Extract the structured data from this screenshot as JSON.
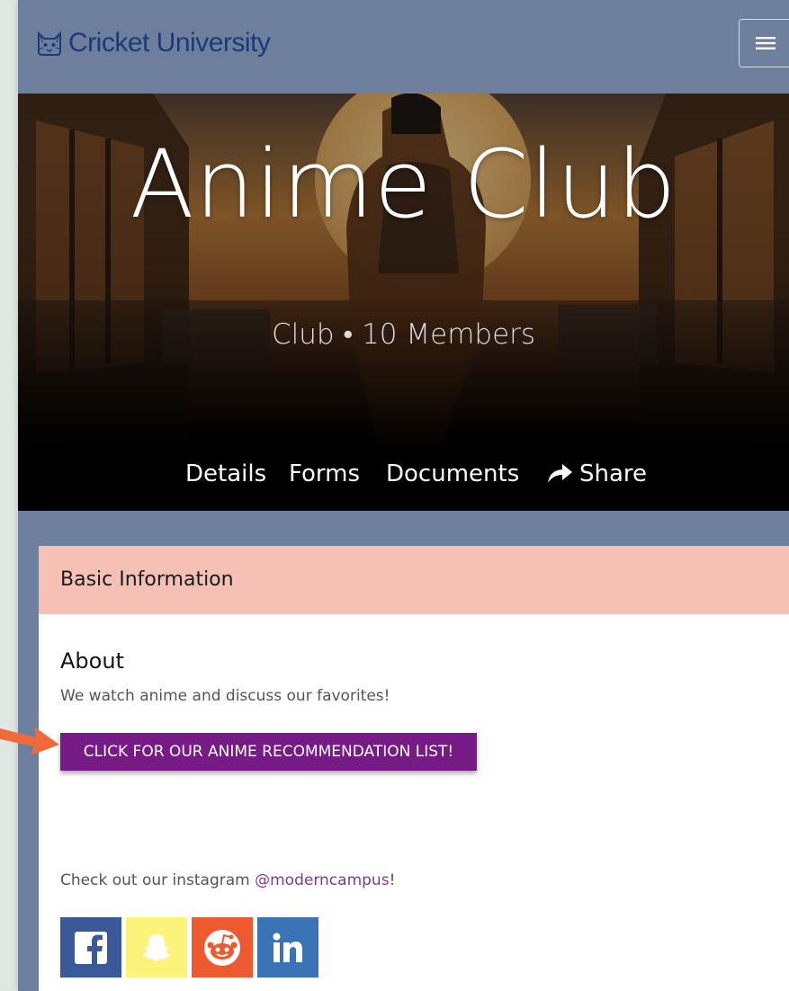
{
  "header": {
    "logo_text": "Cricket University",
    "menu_icon": "hamburger-menu-icon"
  },
  "hero": {
    "title": "Anime Club",
    "subtitle": "Club • 10 Members"
  },
  "tabs": [
    {
      "label": "Details",
      "active": true
    },
    {
      "label": "Forms"
    },
    {
      "label": "Documents"
    },
    {
      "label": "Share",
      "icon": "share-arrow-icon"
    }
  ],
  "card": {
    "header": "Basic Information",
    "about_heading": "About",
    "about_text": "We watch anime and discuss our favorites!",
    "button_label": "CLICK FOR OUR ANIME RECOMMENDATION LIST!",
    "instagram_prefix": "Check out our instagram ",
    "instagram_handle": "@moderncampus",
    "instagram_suffix": "!",
    "socials": [
      {
        "name": "facebook",
        "color": "#3b5998"
      },
      {
        "name": "snapchat",
        "color": "#fbf37a"
      },
      {
        "name": "reddit",
        "color": "#ee5a2f"
      },
      {
        "name": "linkedin",
        "color": "#3a73b4"
      }
    ]
  },
  "colors": {
    "page_bg": "#6d7f9d",
    "logo": "#1c3a78",
    "card_header": "#f5c1b4",
    "button": "#761a85",
    "link": "#7c3a8e",
    "arrow": "#f26a3a"
  }
}
